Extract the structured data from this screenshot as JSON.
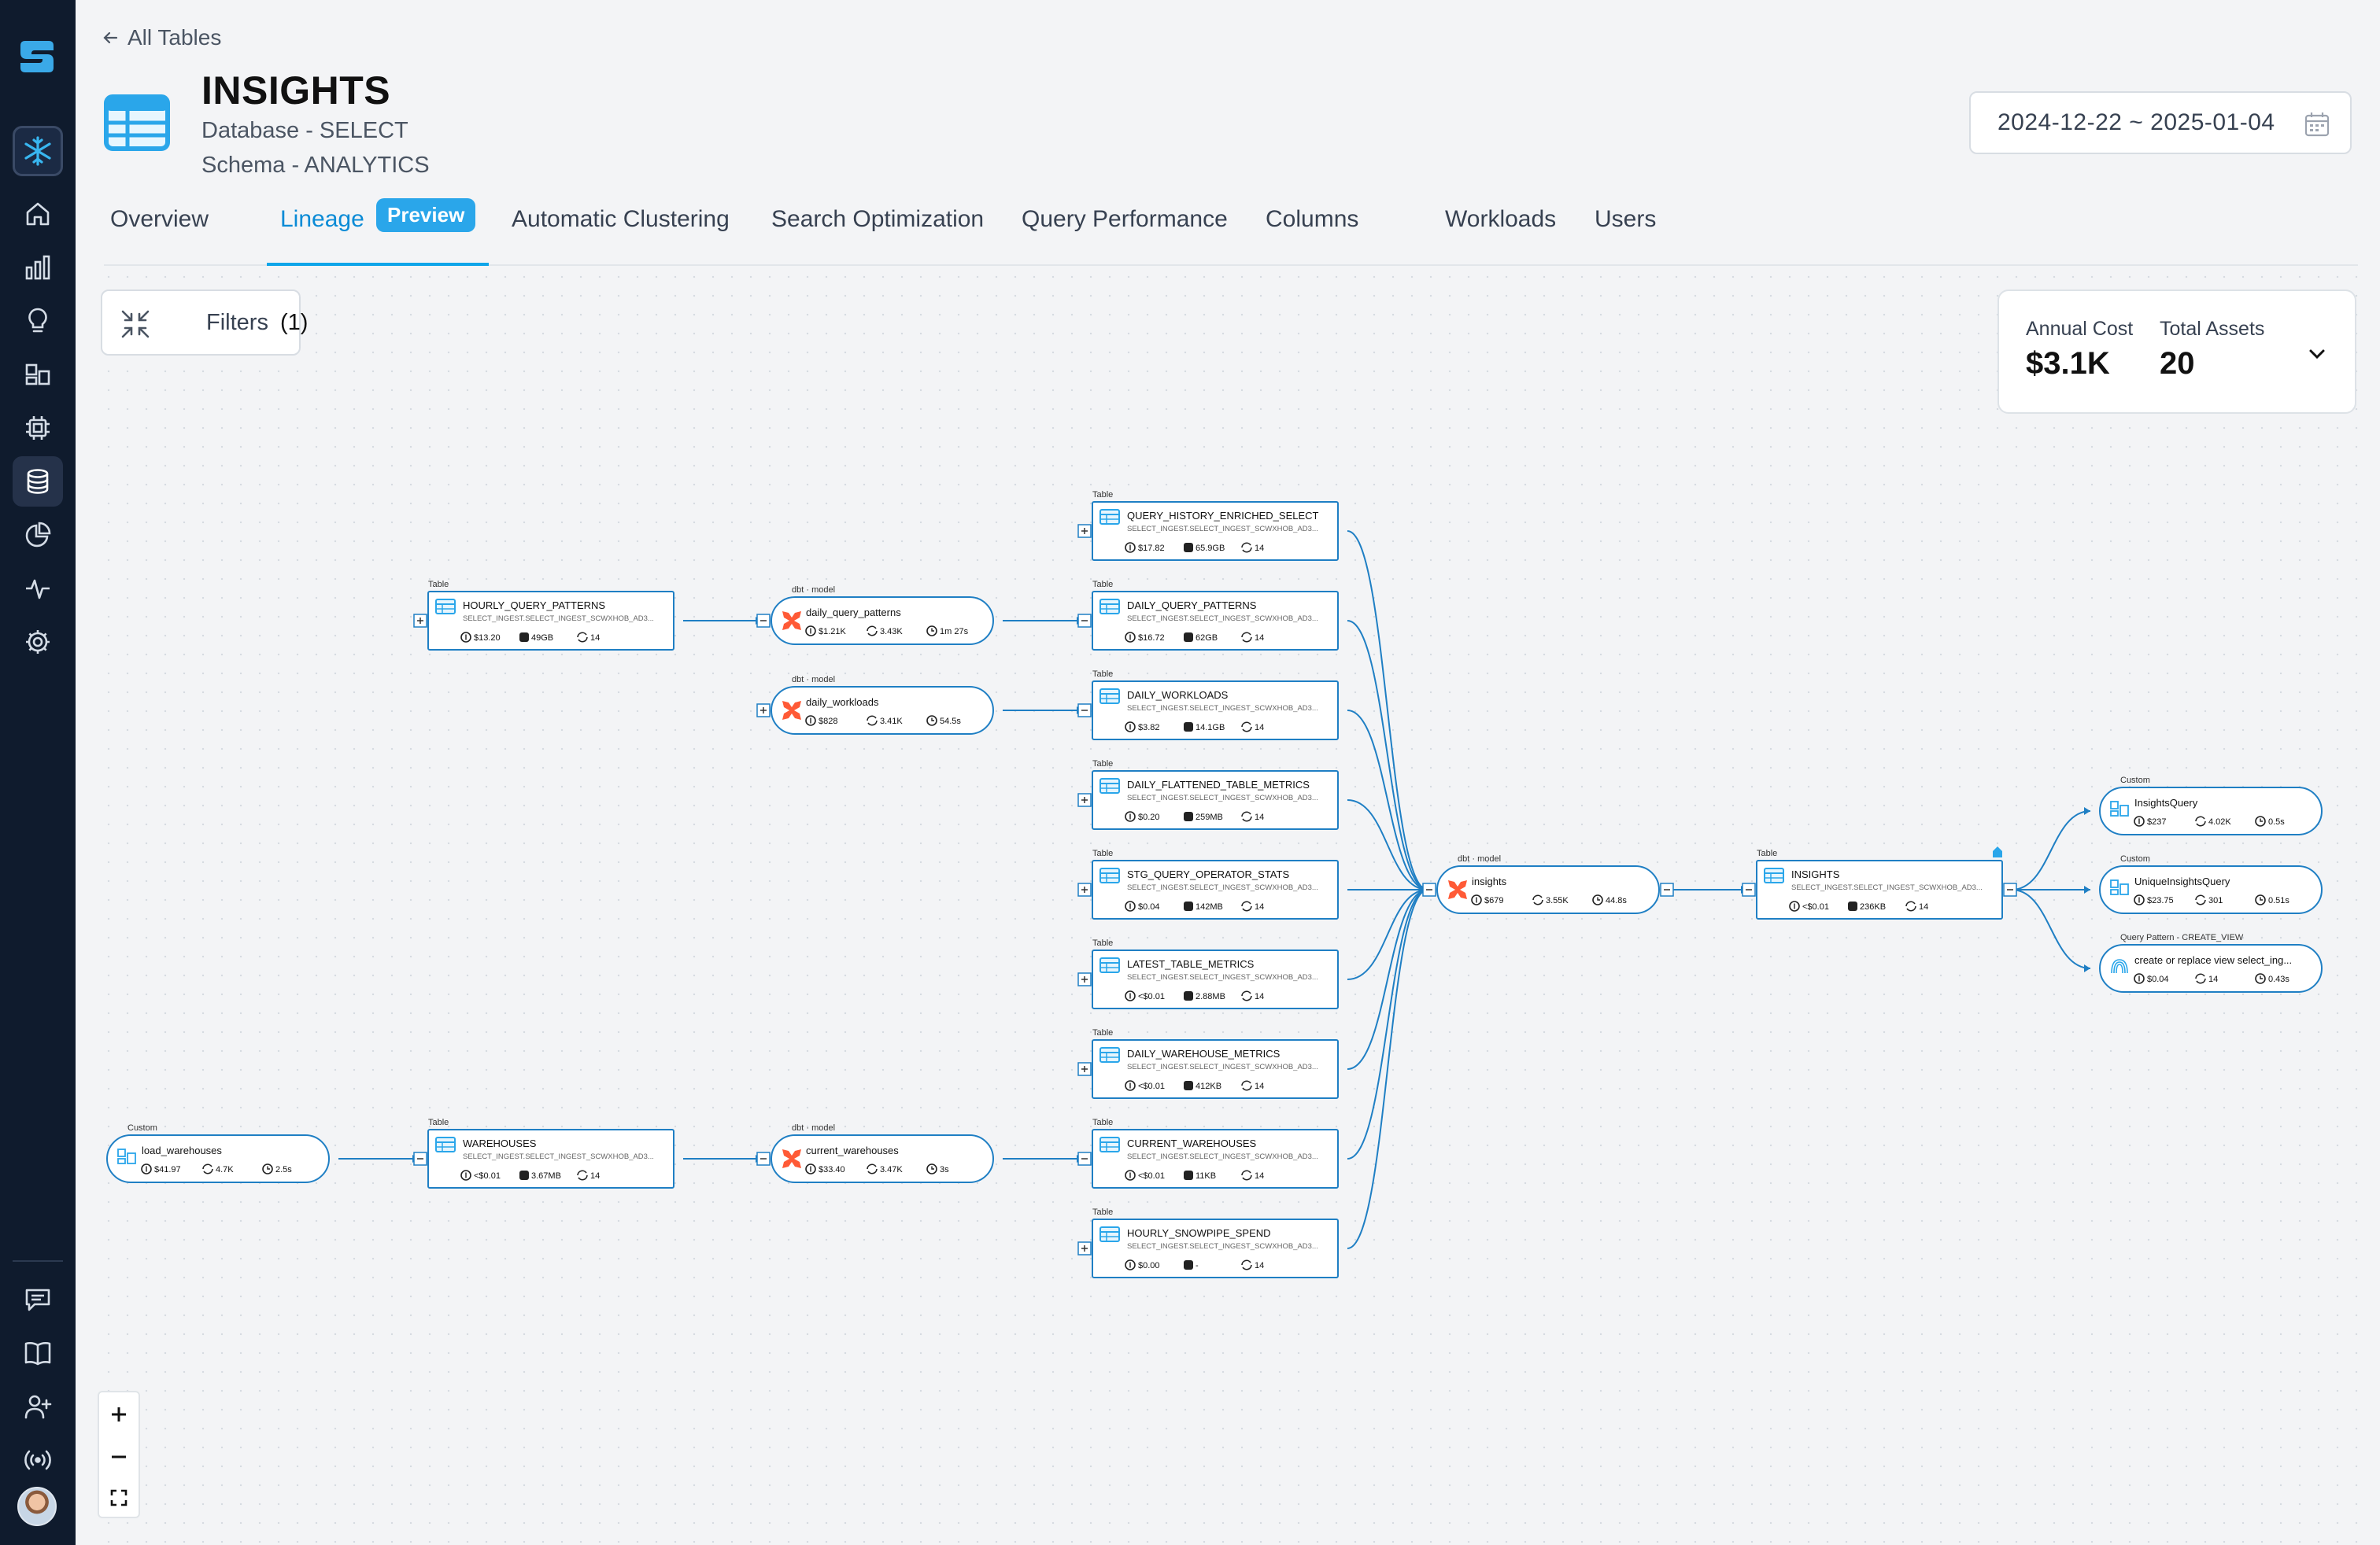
{
  "back": {
    "label": "All Tables"
  },
  "header": {
    "title": "INSIGHTS",
    "database": "Database - SELECT",
    "schema": "Schema - ANALYTICS",
    "date_range": "2024-12-22 ~ 2025-01-04"
  },
  "tabs": [
    {
      "label": "Overview"
    },
    {
      "label": "Lineage",
      "active": true
    },
    {
      "label": "Automatic Clustering"
    },
    {
      "label": "Search Optimization"
    },
    {
      "label": "Query Performance"
    },
    {
      "label": "Columns"
    },
    {
      "label": "Workloads"
    },
    {
      "label": "Users"
    }
  ],
  "preview_badge": "Preview",
  "filters": {
    "label": "Filters",
    "count": "(1)"
  },
  "summary": {
    "annual_cost_label": "Annual Cost",
    "annual_cost": "$3.1K",
    "total_assets_label": "Total Assets",
    "total_assets": "20"
  },
  "colors": {
    "accent": "#0ea5e9",
    "sidebar": "#0f1b2d",
    "edge": "#1f7fc4",
    "dbt": "#ff5a36"
  },
  "sidebar_icons": [
    "app-logo-icon",
    "snowflake-icon",
    "home-icon",
    "bar-chart-icon",
    "lightbulb-icon",
    "dashboard-icon",
    "chip-icon",
    "database-icon",
    "pie-chart-icon",
    "activity-icon",
    "settings-icon",
    "chat-icon",
    "book-icon",
    "add-user-icon",
    "broadcast-icon"
  ],
  "nodes": [
    {
      "id": "hqp",
      "kind": "table",
      "type_label": "Table",
      "name": "HOURLY_QUERY_PATTERNS",
      "path": "SELECT_INGEST.SELECT_INGEST_SCWXHOB_AD3...",
      "cost": "$13.20",
      "size": "49GB",
      "runs": "14"
    },
    {
      "id": "dqp_m",
      "kind": "dbt",
      "type_label": "dbt · model",
      "name": "daily_query_patterns",
      "cost": "$1.21K",
      "runs": "3.43K",
      "time": "1m 27s"
    },
    {
      "id": "dw_m",
      "kind": "dbt",
      "type_label": "dbt · model",
      "name": "daily_workloads",
      "cost": "$828",
      "runs": "3.41K",
      "time": "54.5s"
    },
    {
      "id": "qhe",
      "kind": "table",
      "type_label": "Table",
      "name": "QUERY_HISTORY_ENRICHED_SELECT",
      "path": "SELECT_INGEST.SELECT_INGEST_SCWXHOB_AD3...",
      "cost": "$17.82",
      "size": "65.9GB",
      "runs": "14"
    },
    {
      "id": "dqp",
      "kind": "table",
      "type_label": "Table",
      "name": "DAILY_QUERY_PATTERNS",
      "path": "SELECT_INGEST.SELECT_INGEST_SCWXHOB_AD3...",
      "cost": "$16.72",
      "size": "62GB",
      "runs": "14"
    },
    {
      "id": "dwl",
      "kind": "table",
      "type_label": "Table",
      "name": "DAILY_WORKLOADS",
      "path": "SELECT_INGEST.SELECT_INGEST_SCWXHOB_AD3...",
      "cost": "$3.82",
      "size": "14.1GB",
      "runs": "14"
    },
    {
      "id": "dftm",
      "kind": "table",
      "type_label": "Table",
      "name": "DAILY_FLATTENED_TABLE_METRICS",
      "path": "SELECT_INGEST.SELECT_INGEST_SCWXHOB_AD3...",
      "cost": "$0.20",
      "size": "259MB",
      "runs": "14"
    },
    {
      "id": "sqos",
      "kind": "table",
      "type_label": "Table",
      "name": "STG_QUERY_OPERATOR_STATS",
      "path": "SELECT_INGEST.SELECT_INGEST_SCWXHOB_AD3...",
      "cost": "$0.04",
      "size": "142MB",
      "runs": "14"
    },
    {
      "id": "ltm",
      "kind": "table",
      "type_label": "Table",
      "name": "LATEST_TABLE_METRICS",
      "path": "SELECT_INGEST.SELECT_INGEST_SCWXHOB_AD3...",
      "cost": "<$0.01",
      "size": "2.88MB",
      "runs": "14"
    },
    {
      "id": "dwm",
      "kind": "table",
      "type_label": "Table",
      "name": "DAILY_WAREHOUSE_METRICS",
      "path": "SELECT_INGEST.SELECT_INGEST_SCWXHOB_AD3...",
      "cost": "<$0.01",
      "size": "412KB",
      "runs": "14"
    },
    {
      "id": "cw",
      "kind": "table",
      "type_label": "Table",
      "name": "CURRENT_WAREHOUSES",
      "path": "SELECT_INGEST.SELECT_INGEST_SCWXHOB_AD3...",
      "cost": "<$0.01",
      "size": "11KB",
      "runs": "14"
    },
    {
      "id": "hss",
      "kind": "table",
      "type_label": "Table",
      "name": "HOURLY_SNOWPIPE_SPEND",
      "path": "SELECT_INGEST.SELECT_INGEST_SCWXHOB_AD3...",
      "cost": "$0.00",
      "size": "-",
      "runs": "14"
    },
    {
      "id": "lw",
      "kind": "custom",
      "type_label": "Custom",
      "name": "load_warehouses",
      "cost": "$41.97",
      "runs": "4.7K",
      "time": "2.5s"
    },
    {
      "id": "wh",
      "kind": "table",
      "type_label": "Table",
      "name": "WAREHOUSES",
      "path": "SELECT_INGEST.SELECT_INGEST_SCWXHOB_AD3...",
      "cost": "<$0.01",
      "size": "3.67MB",
      "runs": "14"
    },
    {
      "id": "cw_m",
      "kind": "dbt",
      "type_label": "dbt · model",
      "name": "current_warehouses",
      "cost": "$33.40",
      "runs": "3.47K",
      "time": "3s"
    },
    {
      "id": "ins_m",
      "kind": "dbt",
      "type_label": "dbt · model",
      "name": "insights",
      "cost": "$679",
      "runs": "3.55K",
      "time": "44.8s"
    },
    {
      "id": "ins",
      "kind": "table",
      "type_label": "Table",
      "name": "INSIGHTS",
      "path": "SELECT_INGEST.SELECT_INGEST_SCWXHOB_AD3...",
      "cost": "<$0.01",
      "size": "236KB",
      "runs": "14"
    },
    {
      "id": "iq",
      "kind": "custom",
      "type_label": "Custom",
      "name": "InsightsQuery",
      "cost": "$237",
      "runs": "4.02K",
      "time": "0.5s"
    },
    {
      "id": "uiq",
      "kind": "custom",
      "type_label": "Custom",
      "name": "UniqueInsightsQuery",
      "cost": "$23.75",
      "runs": "301",
      "time": "0.51s"
    },
    {
      "id": "qp",
      "kind": "pattern",
      "type_label": "Query Pattern - CREATE_VIEW",
      "name": "create or replace view select_ing...",
      "cost": "$0.04",
      "runs": "14",
      "time": "0.43s"
    }
  ],
  "edges": [
    [
      "hqp",
      "dqp_m"
    ],
    [
      "dqp_m",
      "dqp"
    ],
    [
      "dw_m",
      "dwl"
    ],
    [
      "lw",
      "wh"
    ],
    [
      "wh",
      "cw_m"
    ],
    [
      "cw_m",
      "cw"
    ],
    [
      "qhe",
      "ins_m"
    ],
    [
      "dqp",
      "ins_m"
    ],
    [
      "dwl",
      "ins_m"
    ],
    [
      "dftm",
      "ins_m"
    ],
    [
      "sqos",
      "ins_m"
    ],
    [
      "ltm",
      "ins_m"
    ],
    [
      "dwm",
      "ins_m"
    ],
    [
      "cw",
      "ins_m"
    ],
    [
      "hss",
      "ins_m"
    ],
    [
      "ins_m",
      "ins"
    ],
    [
      "ins",
      "iq"
    ],
    [
      "ins",
      "uiq"
    ],
    [
      "ins",
      "qp"
    ]
  ]
}
